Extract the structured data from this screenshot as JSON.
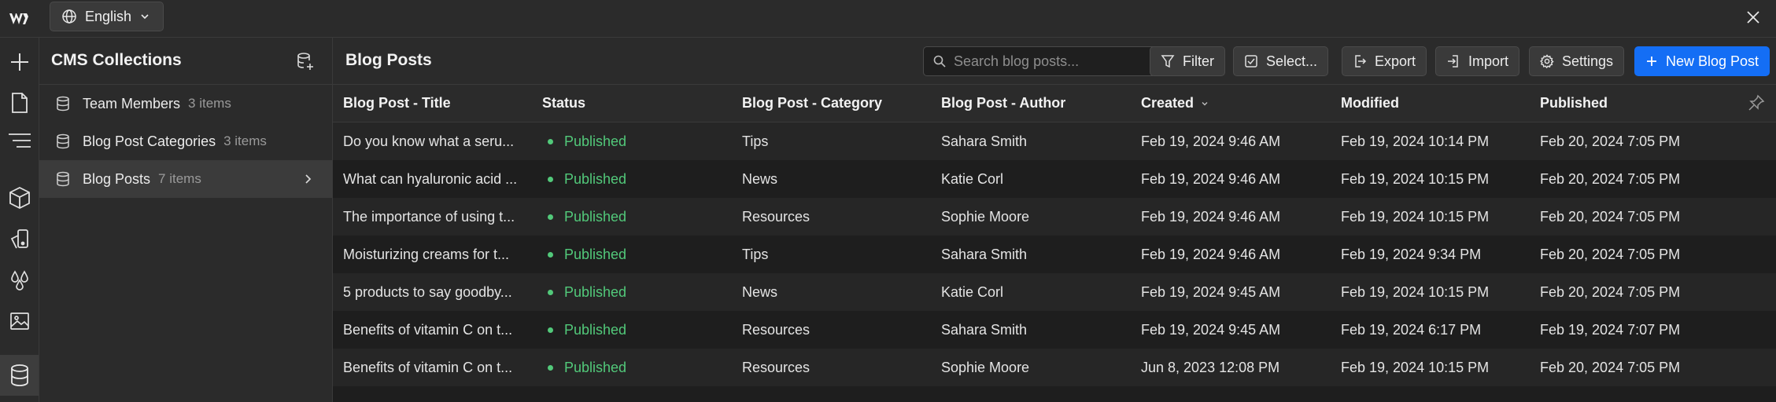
{
  "topbar": {
    "language": "English"
  },
  "rail": {
    "icons": [
      "plus-icon",
      "page-icon",
      "navigator-icon",
      "components-icon",
      "style-icon",
      "variables-icon",
      "assets-icon",
      "cms-icon"
    ]
  },
  "collections": {
    "title": "CMS Collections",
    "items": [
      {
        "name": "Team Members",
        "count": "3 items"
      },
      {
        "name": "Blog Post Categories",
        "count": "3 items"
      },
      {
        "name": "Blog Posts",
        "count": "7 items"
      }
    ]
  },
  "main": {
    "title": "Blog Posts",
    "search_placeholder": "Search blog posts...",
    "buttons": {
      "filter": "Filter",
      "select": "Select...",
      "export": "Export",
      "import": "Import",
      "settings": "Settings",
      "new": "New Blog Post"
    },
    "columns": [
      "Blog Post - Title",
      "Status",
      "Blog Post - Category",
      "Blog Post - Author",
      "Created",
      "Modified",
      "Published"
    ],
    "rows": [
      {
        "title": "Do you know what a seru...",
        "status": "Published",
        "category": "Tips",
        "author": "Sahara Smith",
        "created": "Feb 19, 2024 9:46 AM",
        "modified": "Feb 19, 2024 10:14 PM",
        "published": "Feb 20, 2024 7:05 PM"
      },
      {
        "title": "What can hyaluronic acid ...",
        "status": "Published",
        "category": "News",
        "author": "Katie Corl",
        "created": "Feb 19, 2024 9:46 AM",
        "modified": "Feb 19, 2024 10:15 PM",
        "published": "Feb 20, 2024 7:05 PM"
      },
      {
        "title": "The importance of using t...",
        "status": "Published",
        "category": "Resources",
        "author": "Sophie Moore",
        "created": "Feb 19, 2024 9:46 AM",
        "modified": "Feb 19, 2024 10:15 PM",
        "published": "Feb 20, 2024 7:05 PM"
      },
      {
        "title": "Moisturizing creams for t...",
        "status": "Published",
        "category": "Tips",
        "author": "Sahara Smith",
        "created": "Feb 19, 2024 9:46 AM",
        "modified": "Feb 19, 2024 9:34 PM",
        "published": "Feb 20, 2024 7:05 PM"
      },
      {
        "title": "5 products to say goodby...",
        "status": "Published",
        "category": "News",
        "author": "Katie Corl",
        "created": "Feb 19, 2024 9:45 AM",
        "modified": "Feb 19, 2024 10:15 PM",
        "published": "Feb 20, 2024 7:05 PM"
      },
      {
        "title": "Benefits of vitamin C on t...",
        "status": "Published",
        "category": "Resources",
        "author": "Sahara Smith",
        "created": "Feb 19, 2024 9:45 AM",
        "modified": "Feb 19, 2024 6:17 PM",
        "published": "Feb 19, 2024 7:07 PM"
      },
      {
        "title": "Benefits of vitamin C on t...",
        "status": "Published",
        "category": "Resources",
        "author": "Sophie Moore",
        "created": "Jun 8, 2023 12:08 PM",
        "modified": "Feb 19, 2024 10:15 PM",
        "published": "Feb 20, 2024 7:05 PM"
      }
    ]
  },
  "colors": {
    "accent": "#146ef5",
    "published": "#52c97a",
    "background": "#1e1e1e",
    "panel": "#2b2b2b"
  }
}
